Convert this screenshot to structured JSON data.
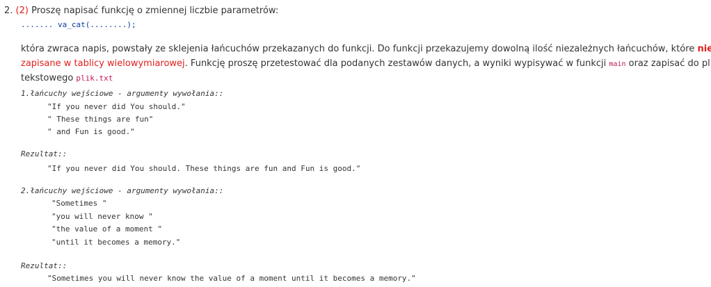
{
  "exercise": {
    "number": "2.",
    "points_open": "(",
    "points": "2",
    "points_close": ")",
    "title": "Proszę napisać funkcję o zmiennej liczbie parametrów:",
    "signature": "....... va_cat(........);"
  },
  "description": {
    "text1": "która zwraca napis, powstały ze sklejenia łańcuchów przekazanych do funkcji. Do funkcji przekazujemy dowolną ilość niezależnych łańcuchów, które ",
    "emph_bold": "nie są",
    "emph_line2": "zapisane w tablicy wielowymiarowej",
    "text2": ". Funkcję proszę przetestować dla podanych zestawów danych, a wyniki wypisywać w funkcji ",
    "code_main": "main",
    "text3": " oraz zapisać do pliku",
    "text4": "tekstowego ",
    "code_file": "plik.txt"
  },
  "examples": [
    {
      "input_label": "1.łańcuchy wejściowe - argumenty wywołania::",
      "inputs": [
        "\"If you never did You should.\"",
        "\" These things are fun\"",
        "\" and Fun is good.\""
      ],
      "result_label": "Rezultat::",
      "result": "\"If you never did You should. These things are fun and Fun is good.\""
    },
    {
      "input_label": "2.łańcuchy wejściowe - argumenty wywołania::",
      "inputs": [
        "\"Sometimes \"",
        "\"you will never know \"",
        "\"the value of a moment \"",
        "\"until it becomes a memory.\""
      ],
      "result_label": "Rezultat::",
      "result": "\"Sometimes you will never know the value of a moment until it becomes a memory.\""
    }
  ]
}
